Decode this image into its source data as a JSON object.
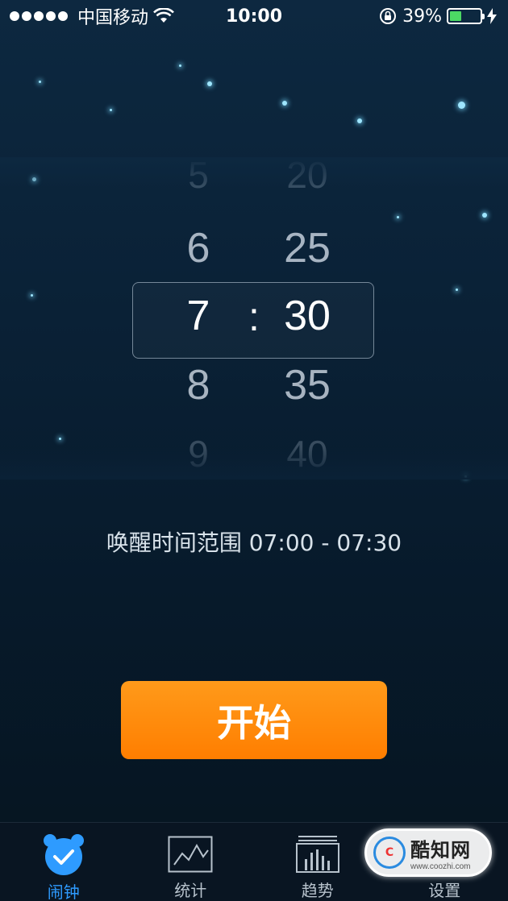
{
  "status_bar": {
    "carrier": "中国移动",
    "time": "10:00",
    "battery_percent": "39%",
    "battery_level": 0.39,
    "battery_color": "#4cd964"
  },
  "picker": {
    "hours": [
      "5",
      "6",
      "7",
      "8",
      "9"
    ],
    "minutes": [
      "20",
      "25",
      "30",
      "35",
      "40"
    ],
    "separator": ":"
  },
  "wake_range": "唤醒时间范围 07:00 - 07:30",
  "start_button": {
    "label": "开始",
    "color": "#ff8a00"
  },
  "tabs": [
    {
      "label": "闹钟",
      "icon": "alarm-clock-icon",
      "active": true
    },
    {
      "label": "统计",
      "icon": "line-chart-icon",
      "active": false
    },
    {
      "label": "趋势",
      "icon": "bar-chart-icon",
      "active": false
    },
    {
      "label": "设置",
      "icon": "settings-icon",
      "active": false
    }
  ],
  "watermark": {
    "title": "酷知网",
    "url": "www.coozhi.com"
  },
  "colors": {
    "accent": "#2e9bff",
    "background": "#0a2136"
  }
}
